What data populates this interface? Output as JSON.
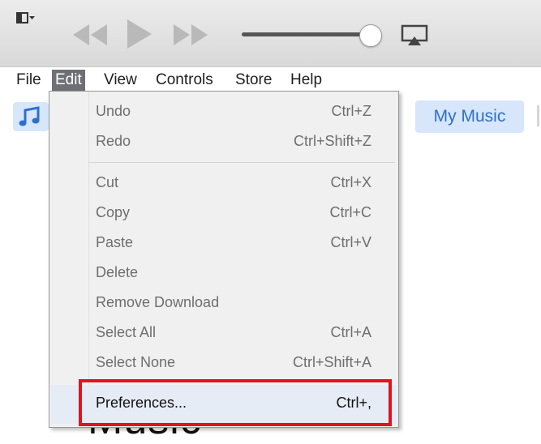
{
  "menubar": {
    "items": [
      "File",
      "Edit",
      "View",
      "Controls",
      "Store",
      "Help"
    ],
    "active": "Edit"
  },
  "toolbar": {
    "my_music_label": "My Music"
  },
  "background": {
    "title_fragment": "Music"
  },
  "edit_menu": {
    "items": [
      {
        "label": "Undo",
        "shortcut": "Ctrl+Z"
      },
      {
        "label": "Redo",
        "shortcut": "Ctrl+Shift+Z"
      },
      {
        "label": "Cut",
        "shortcut": "Ctrl+X"
      },
      {
        "label": "Copy",
        "shortcut": "Ctrl+C"
      },
      {
        "label": "Paste",
        "shortcut": "Ctrl+V"
      },
      {
        "label": "Delete",
        "shortcut": ""
      },
      {
        "label": "Remove Download",
        "shortcut": ""
      },
      {
        "label": "Select All",
        "shortcut": "Ctrl+A"
      },
      {
        "label": "Select None",
        "shortcut": "Ctrl+Shift+A"
      },
      {
        "label": "Preferences...",
        "shortcut": "Ctrl+,"
      }
    ]
  },
  "icons": {
    "window_menu": "window-menu-icon",
    "rewind": "rewind-icon",
    "play": "play-icon",
    "fast_forward": "fast-forward-icon",
    "airplay": "airplay-icon",
    "music_note": "music-note-icon"
  },
  "colors": {
    "highlight_box": "#e0141c",
    "active_menu": "#6d7176",
    "accent_blue": "#2d6fcf",
    "button_bg": "#d7e6fb"
  }
}
